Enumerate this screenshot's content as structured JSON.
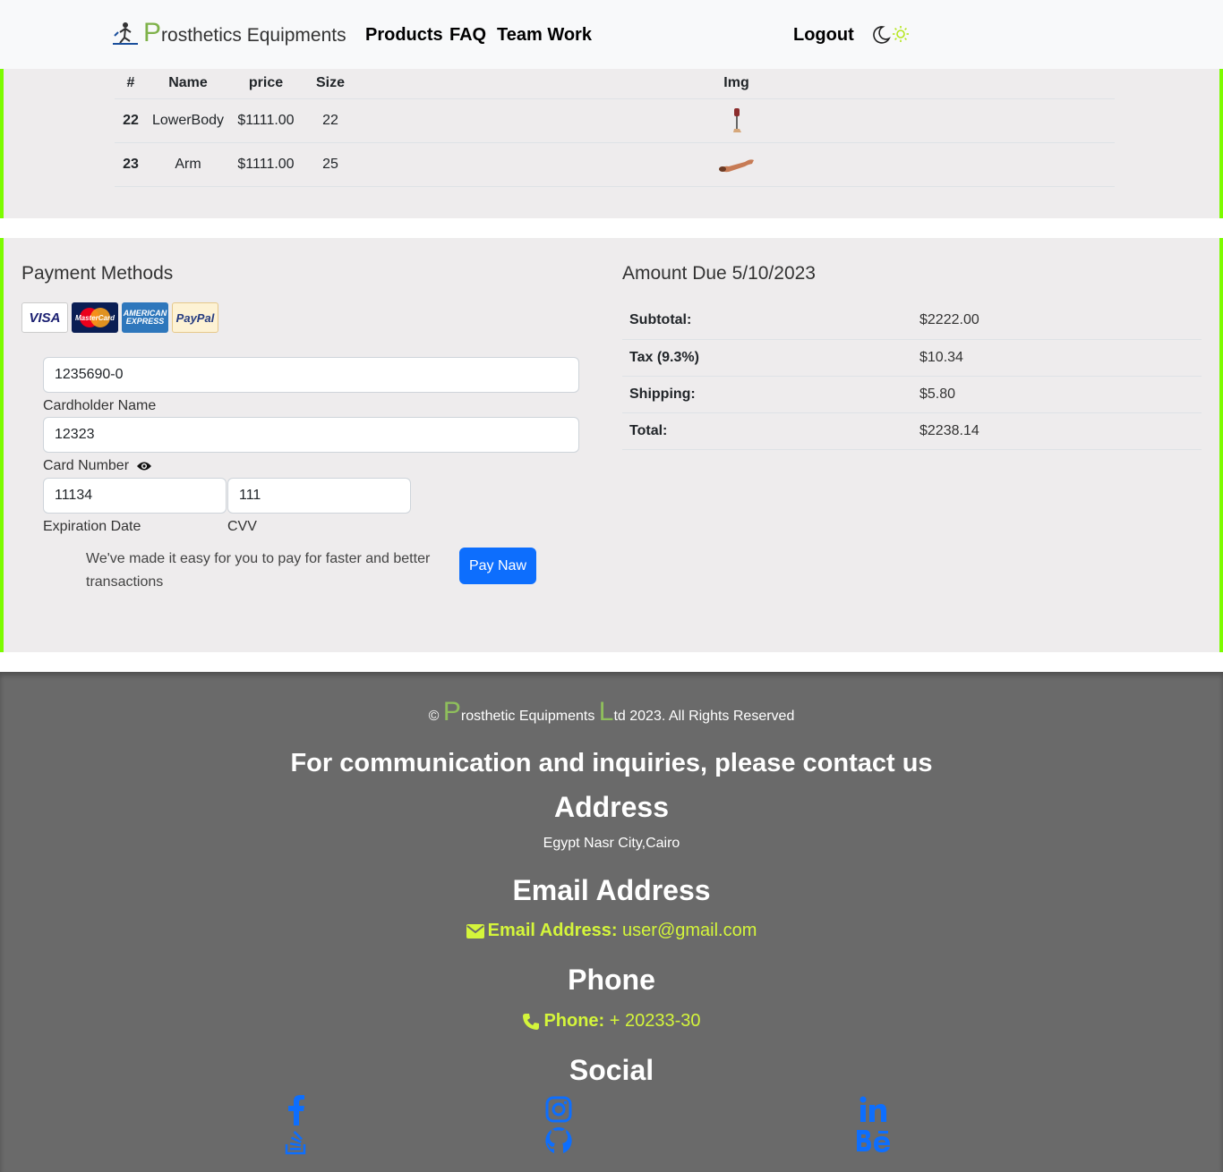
{
  "navbar": {
    "brand_first": "P",
    "brand_rest": "rosthetics Equipments",
    "links": [
      "Products",
      "FAQ",
      "Team Work"
    ],
    "logout": "Logout",
    "theme_icons": [
      "moon-icon",
      "sun-icon"
    ],
    "accent": "#7fb24a"
  },
  "orders": {
    "headers": [
      "#",
      "Name",
      "price",
      "Size",
      "Img"
    ],
    "rows": [
      {
        "id": "22",
        "name": "LowerBody",
        "price": "$1111.00",
        "size": "22",
        "img": "prosthetic-leg-image"
      },
      {
        "id": "23",
        "name": "Arm",
        "price": "$1111.00",
        "size": "25",
        "img": "prosthetic-arm-image"
      }
    ],
    "border_color": "#7cfc00"
  },
  "payment": {
    "title": "Payment Methods",
    "card_logos": [
      "VISA",
      "MasterCard",
      "AMERICAN EXPRESS",
      "PayPal"
    ],
    "name_value": "1235690-0",
    "name_label": "Cardholder Name",
    "card_value": "12323",
    "card_label": "Card Number",
    "exp_value": "11134",
    "exp_label": "Expiration Date",
    "cvv_value": "111",
    "cvv_label": "CVV",
    "hint": "We've made it easy for you to pay for faster and better transactions",
    "pay_button": "Pay Naw",
    "button_color": "#0d6efd"
  },
  "amount": {
    "title": "Amount Due 5/10/2023",
    "rows": [
      {
        "label": "Subtotal:",
        "value": "$2222.00"
      },
      {
        "label": "Tax (9.3%)",
        "value": "$10.34"
      },
      {
        "label": "Shipping:",
        "value": "$5.80"
      },
      {
        "label": "Total:",
        "value": "$2238.14"
      }
    ]
  },
  "footer": {
    "copy_symbol": "©",
    "copy_p": "P",
    "copy_mid": "rosthetic Equipments",
    "copy_l": "L",
    "copy_rest": "td 2023. All Rights Reserved",
    "contact_heading": "For communication and inquiries, please contact us",
    "address_heading": "Address",
    "address": "Egypt Nasr City,Cairo",
    "email_heading": "Email Address",
    "email_label": "Email Address:",
    "email": "user@gmail.com",
    "phone_heading": "Phone",
    "phone_label": "Phone:",
    "phone": "+ 20233-30",
    "social_heading": "Social",
    "social_icons": [
      "facebook-icon",
      "instagram-icon",
      "linkedin-icon",
      "stackoverflow-icon",
      "github-icon",
      "behance-icon"
    ],
    "bg": "#6a6a6a",
    "highlight": "#d4f53b",
    "social_color": "#0d6efd"
  }
}
